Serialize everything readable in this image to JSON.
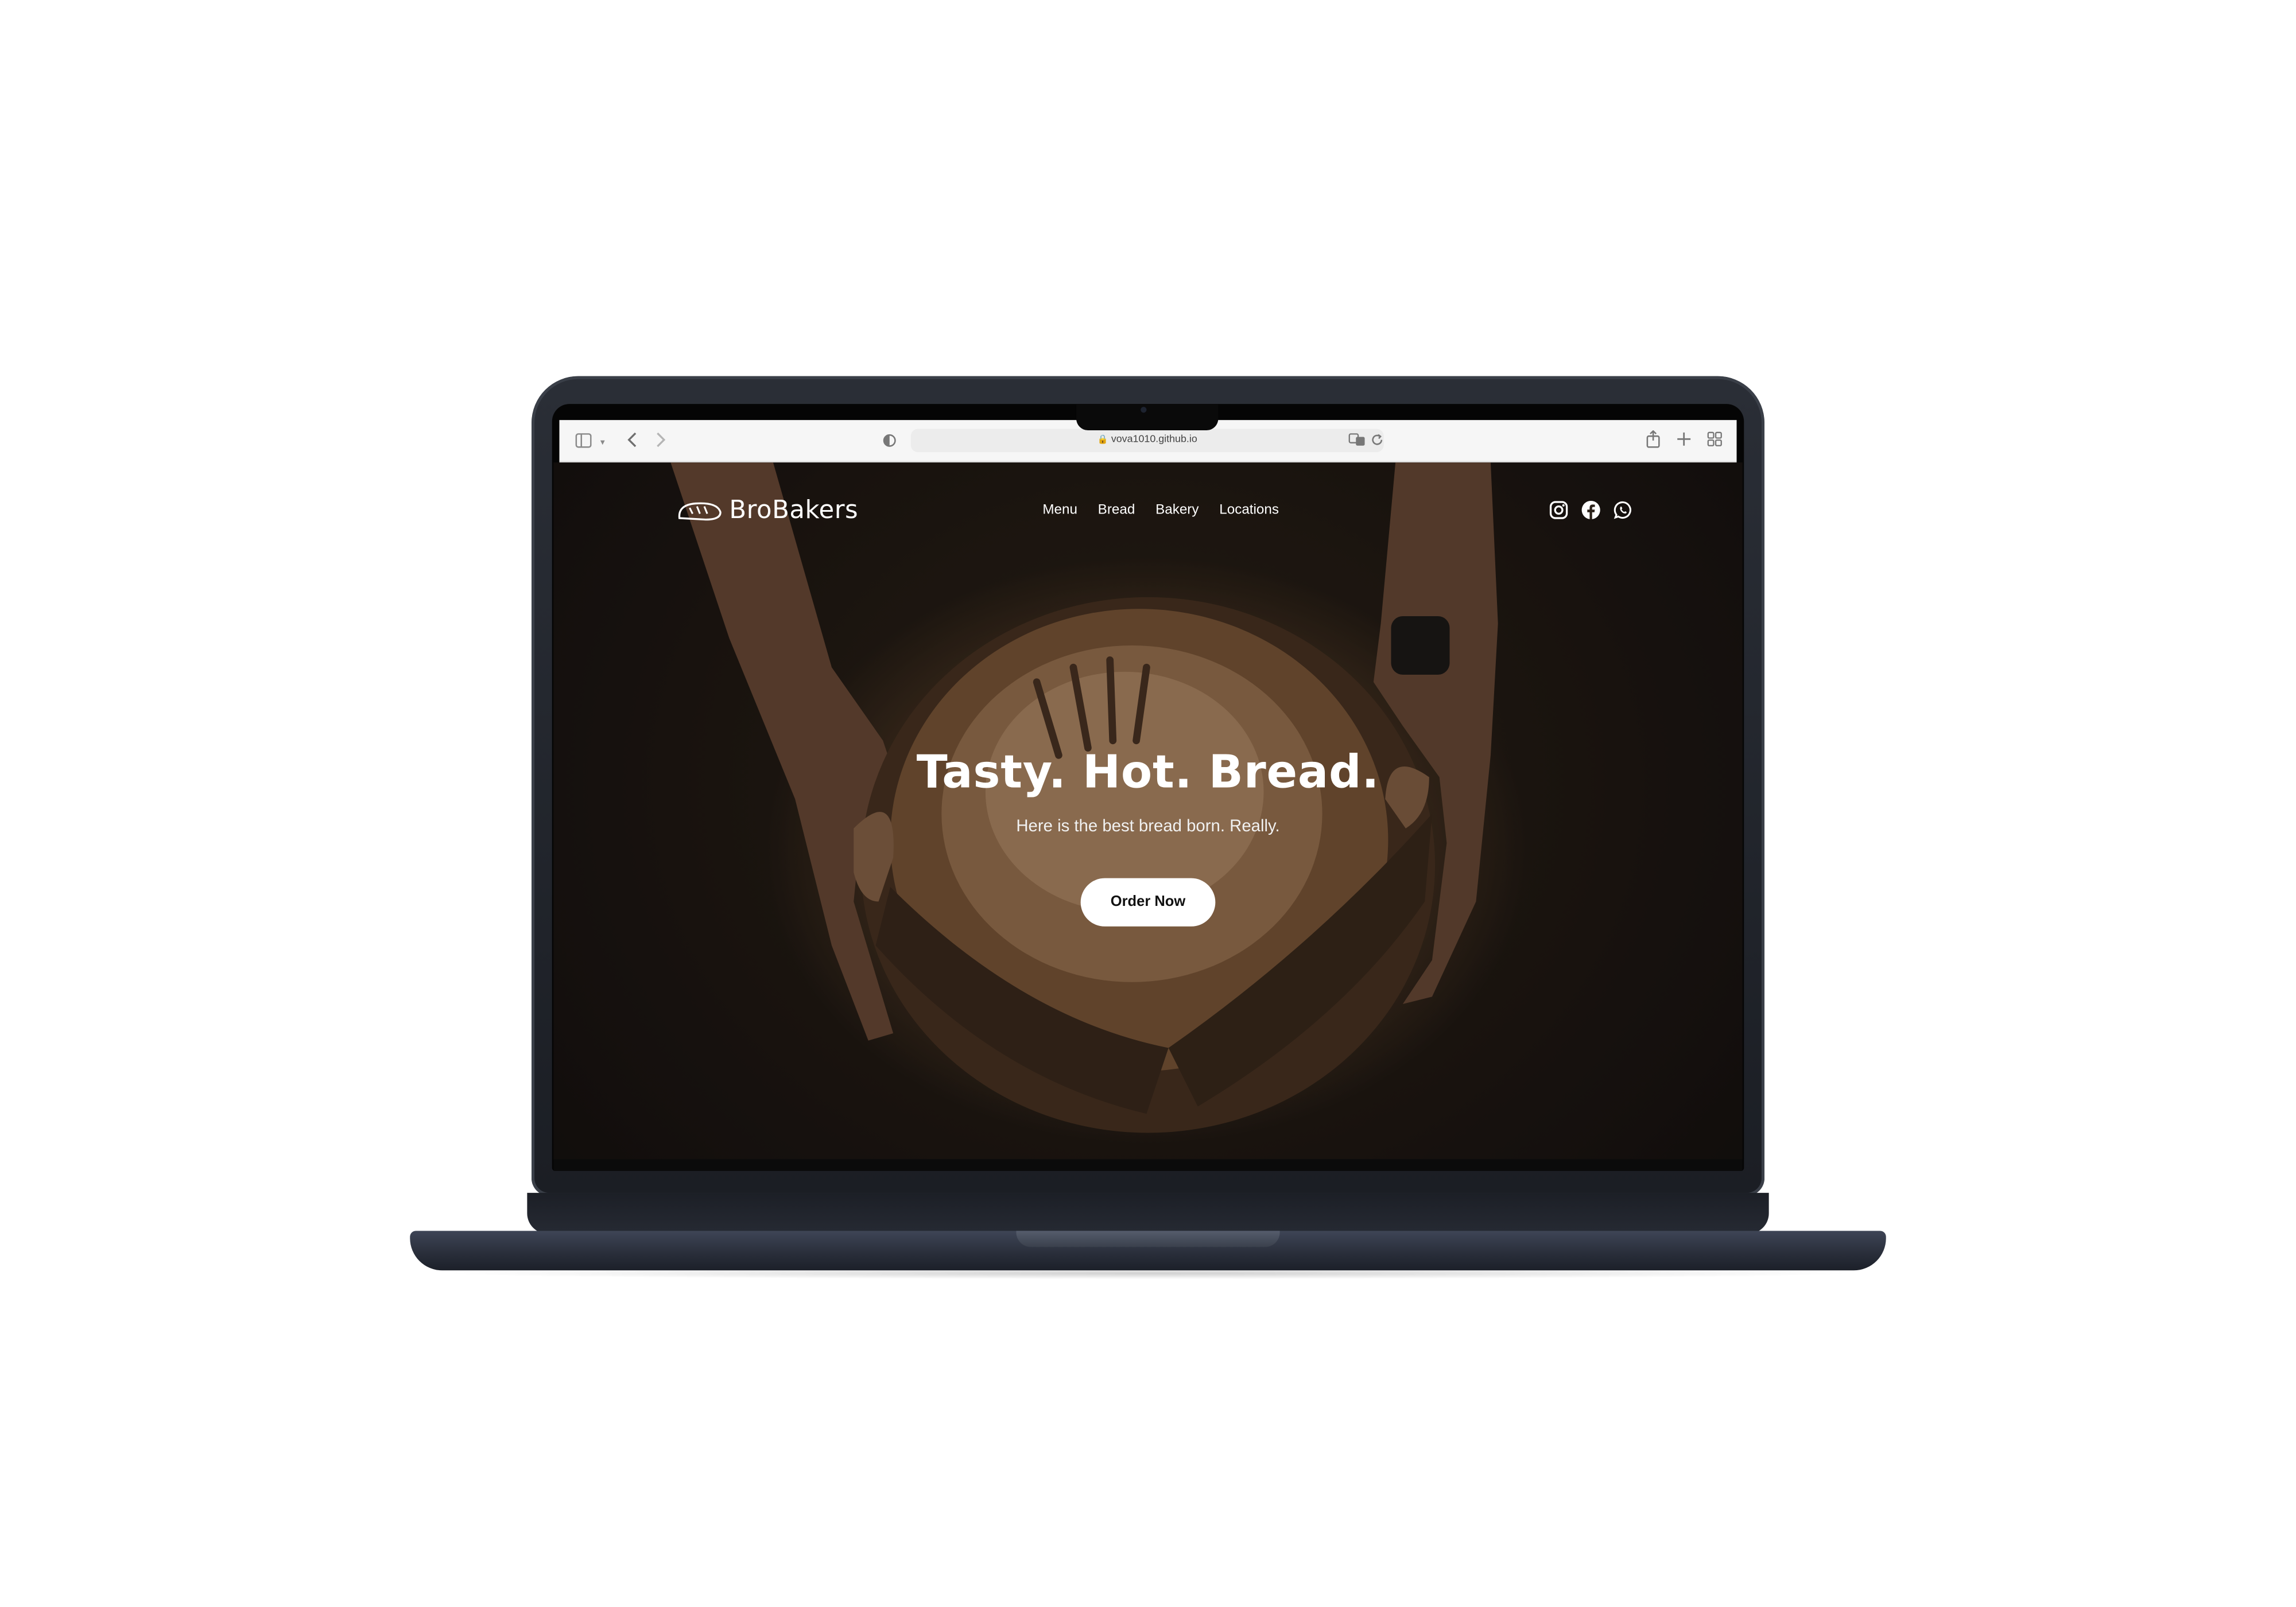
{
  "browser": {
    "url": "vova1010.github.io"
  },
  "site": {
    "brand": "BroBakers",
    "nav": {
      "items": [
        {
          "label": "Menu"
        },
        {
          "label": "Bread"
        },
        {
          "label": "Bakery"
        },
        {
          "label": "Locations"
        }
      ]
    },
    "social_icons": [
      "instagram-icon",
      "facebook-icon",
      "whatsapp-icon"
    ],
    "hero": {
      "title": "Tasty. Hot. Bread.",
      "subtitle": "Here is the best bread born. Really.",
      "cta_label": "Order Now"
    }
  },
  "colors": {
    "laptop_body": "#232730",
    "page_text": "#ffffff",
    "cta_background": "#ffffff",
    "cta_text": "#111111"
  }
}
